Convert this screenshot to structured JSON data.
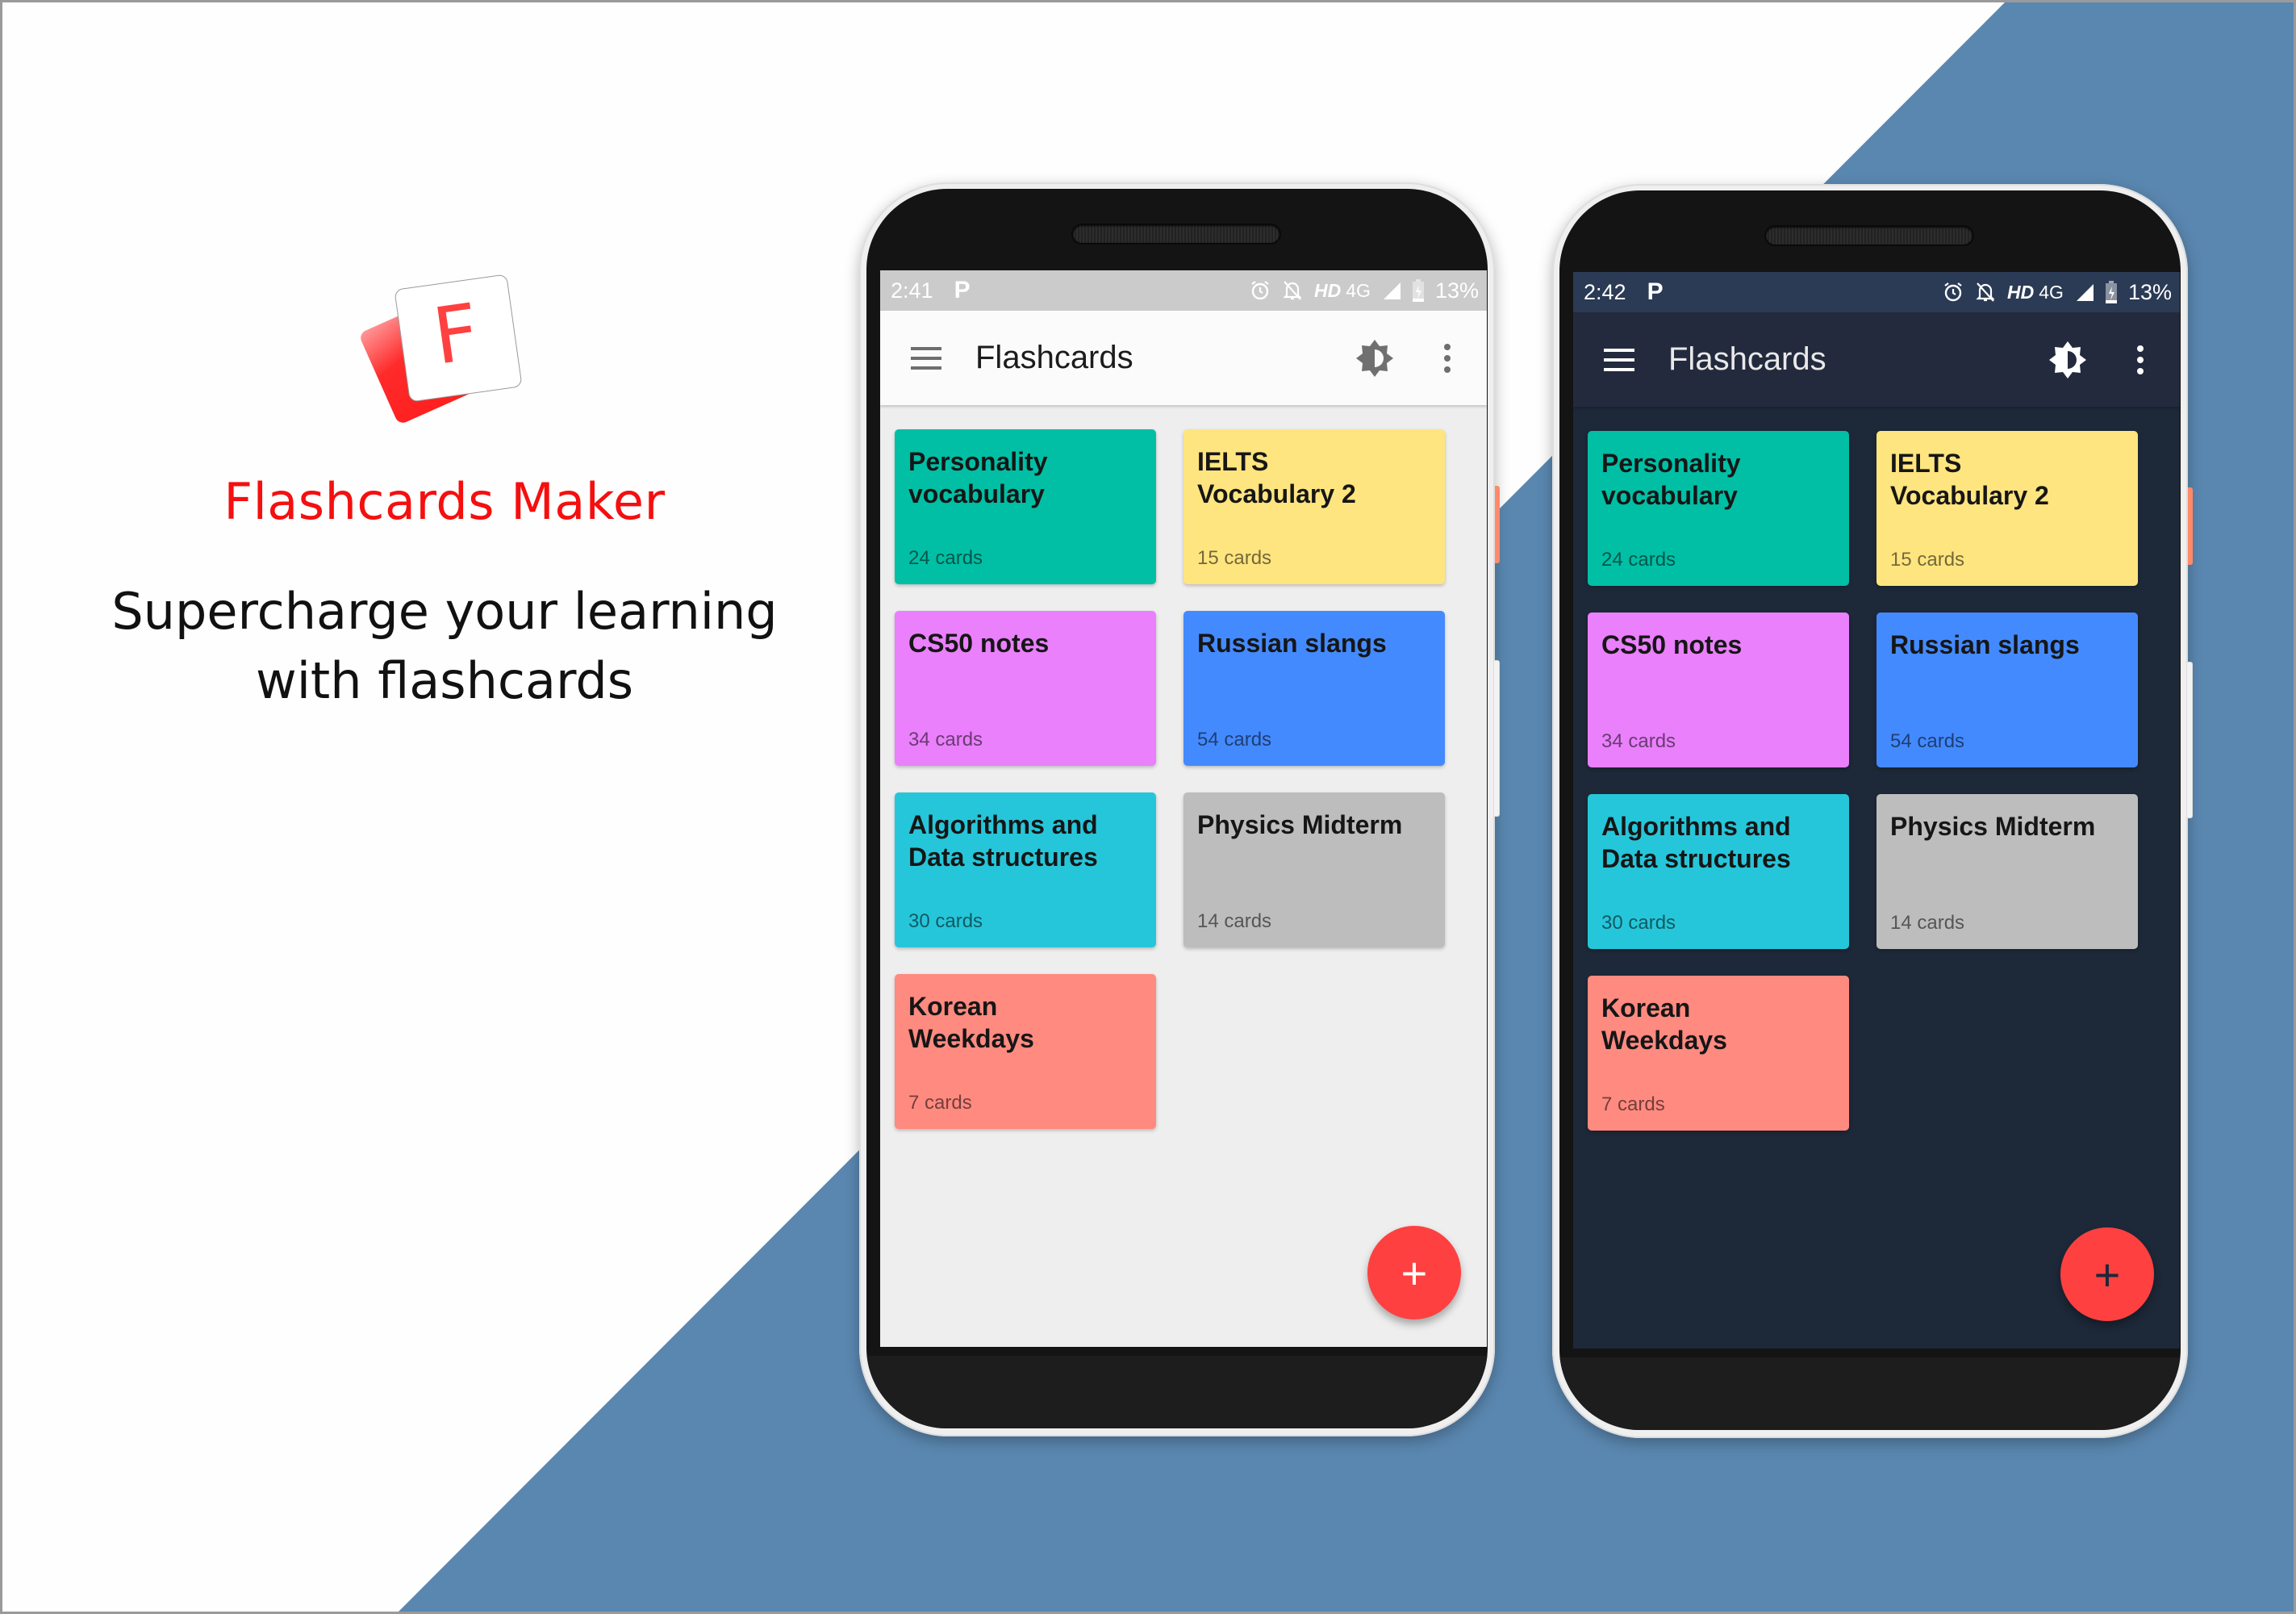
{
  "branding": {
    "app_name": "Flashcards Maker",
    "tagline_line1": "Supercharge your learning",
    "tagline_line2": "with flashcards",
    "logo_letter": "F",
    "brand_color": "#f50f0f"
  },
  "background": {
    "band_color": "#5a87b0",
    "base_color": "#ffffff"
  },
  "phones": [
    {
      "theme": "light",
      "status": {
        "time": "2:41",
        "app_icon": "P",
        "hd": "HD",
        "network": "4G",
        "battery": "13%"
      },
      "appbar": {
        "title": "Flashcards",
        "menu_icon": "hamburger-icon",
        "theme_icon": "brightness-icon",
        "more_icon": "more-vert-icon"
      },
      "fab_label": "+"
    },
    {
      "theme": "dark",
      "status": {
        "time": "2:42",
        "app_icon": "P",
        "hd": "HD",
        "network": "4G",
        "battery": "13%"
      },
      "appbar": {
        "title": "Flashcards",
        "menu_icon": "hamburger-icon",
        "theme_icon": "brightness-icon",
        "more_icon": "more-vert-icon"
      },
      "fab_label": "+"
    }
  ],
  "decks": [
    {
      "name": "Personality vocabulary",
      "line1": "Personality",
      "line2": "vocabulary",
      "count": "24 cards",
      "color": "#00bfa5"
    },
    {
      "name": "IELTS Vocabulary 2",
      "line1": "IELTS",
      "line2": "Vocabulary 2",
      "count": "15 cards",
      "color": "#ffe57f"
    },
    {
      "name": "CS50 notes",
      "line1": "CS50 notes",
      "line2": "",
      "count": "34 cards",
      "color": "#ea80fc"
    },
    {
      "name": "Russian slangs",
      "line1": "Russian slangs",
      "line2": "",
      "count": "54 cards",
      "color": "#448aff"
    },
    {
      "name": "Algorithms and Data structures",
      "line1": "Algorithms and",
      "line2": "Data structures",
      "count": "30 cards",
      "color": "#26c6da"
    },
    {
      "name": "Physics Midterm",
      "line1": "Physics Midterm",
      "line2": "",
      "count": "14 cards",
      "color": "#bdbdbd"
    },
    {
      "name": "Korean Weekdays",
      "line1": "Korean",
      "line2": "Weekdays",
      "count": "7 cards",
      "color": "#ff8a80"
    }
  ],
  "accent": {
    "fab_color": "#ff4040"
  }
}
